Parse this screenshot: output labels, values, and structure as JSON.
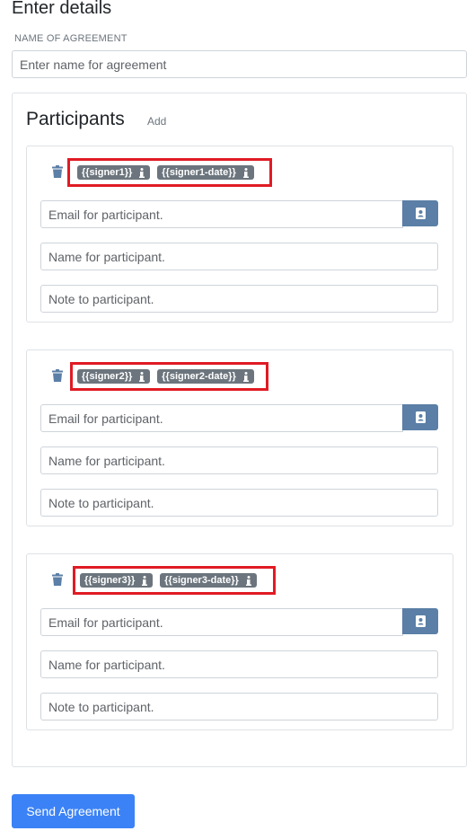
{
  "page_title": "Enter details",
  "agreement": {
    "label": "NAME OF AGREEMENT",
    "placeholder": "Enter name for agreement"
  },
  "participants_section": {
    "title": "Participants",
    "add_label": "Add"
  },
  "participants": [
    {
      "tags": [
        "{{signer1}}",
        "{{signer1-date}}"
      ],
      "email_placeholder": "Email for participant.",
      "name_placeholder": "Name for participant.",
      "note_placeholder": "Note to participant."
    },
    {
      "tags": [
        "{{signer2}}",
        "{{signer2-date}}"
      ],
      "email_placeholder": "Email for participant.",
      "name_placeholder": "Name for participant.",
      "note_placeholder": "Note to participant."
    },
    {
      "tags": [
        "{{signer3}}",
        "{{signer3-date}}"
      ],
      "email_placeholder": "Email for participant.",
      "name_placeholder": "Name for participant.",
      "note_placeholder": "Note to participant."
    }
  ],
  "send_button": "Send Agreement",
  "colors": {
    "primary": "#3b82f6",
    "tag_bg": "#6c757d",
    "highlight_border": "#e01b24",
    "contact_button": "#5b7fa6",
    "trash_icon": "#5b7fa6"
  },
  "icons": {
    "trash": "trash-icon",
    "info": "info-icon",
    "contact": "contact-card-icon"
  }
}
